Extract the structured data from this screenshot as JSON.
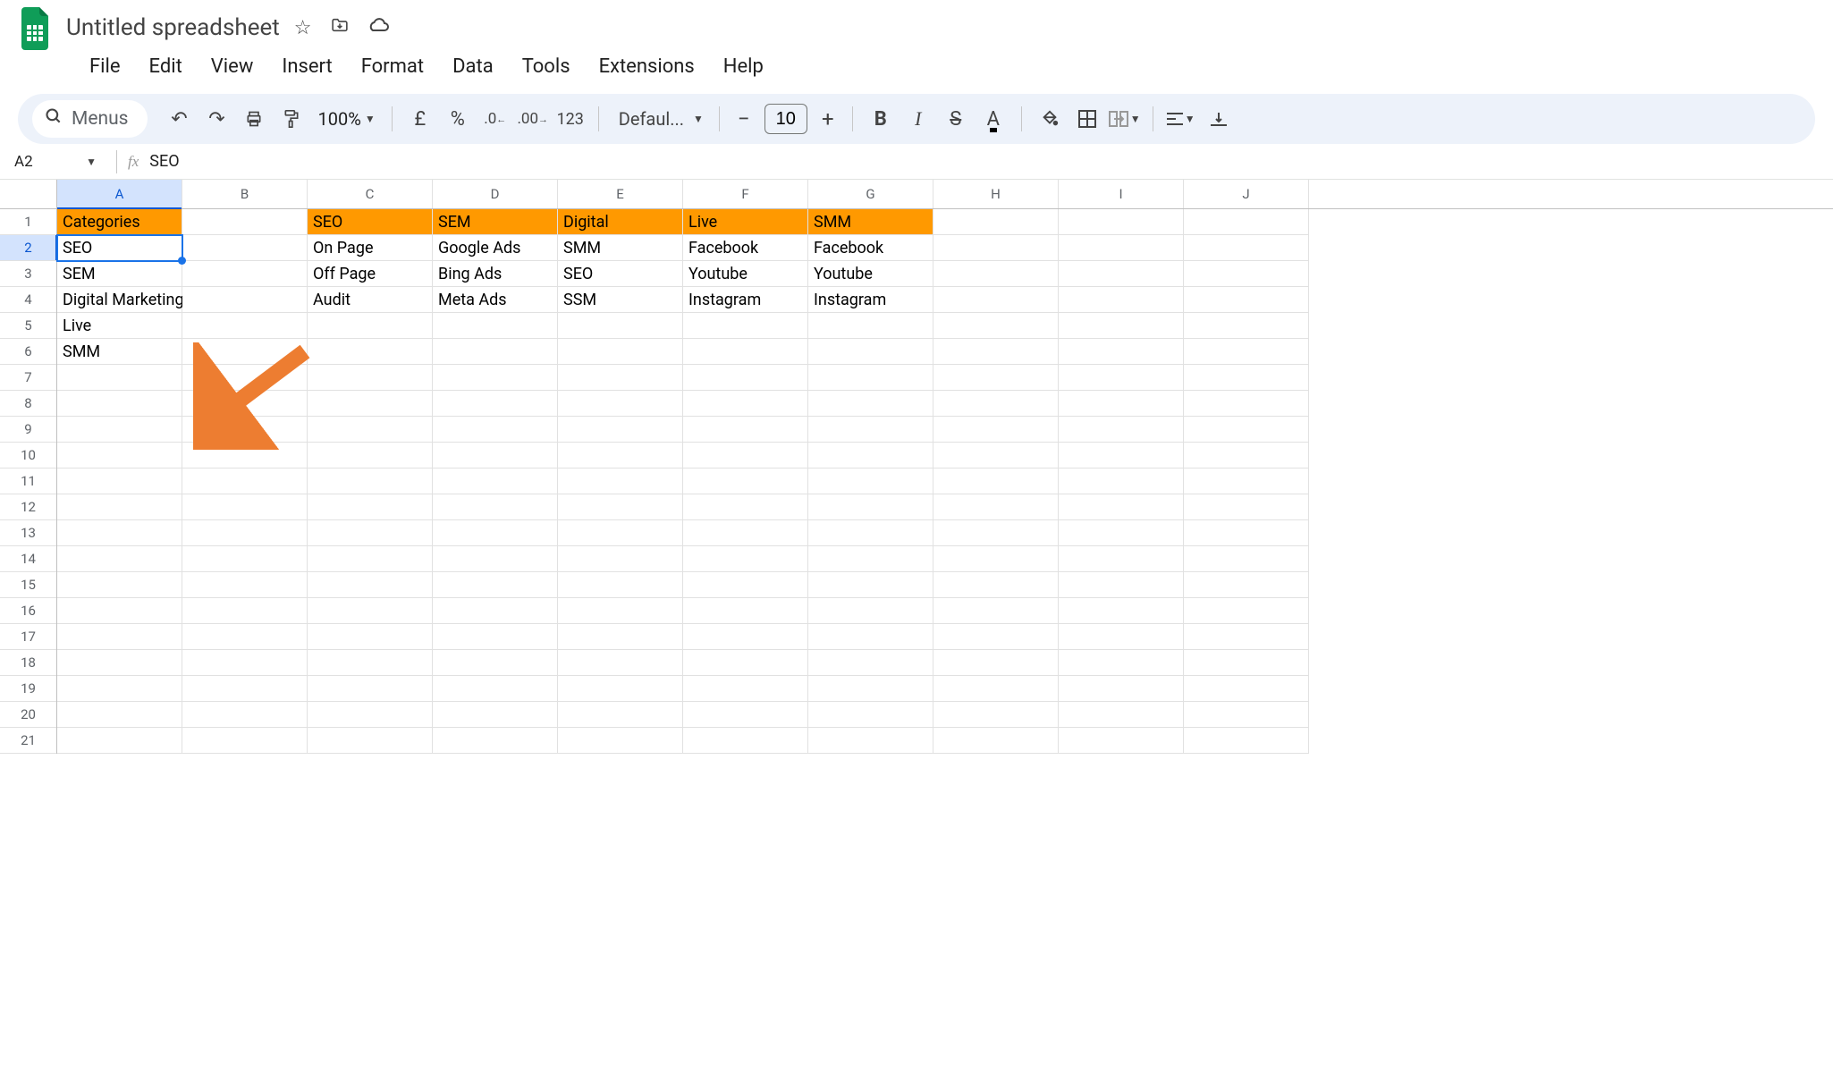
{
  "title": "Untitled spreadsheet",
  "menu": [
    "File",
    "Edit",
    "View",
    "Insert",
    "Format",
    "Data",
    "Tools",
    "Extensions",
    "Help"
  ],
  "toolbar": {
    "menus_label": "Menus",
    "zoom": "100%",
    "currency": "£",
    "percent": "%",
    "number": "123",
    "font": "Defaul...",
    "font_size": "10"
  },
  "namebox": "A2",
  "formula": "SEO",
  "columns": [
    "A",
    "B",
    "C",
    "D",
    "E",
    "F",
    "G",
    "H",
    "I",
    "J"
  ],
  "rows": [
    "1",
    "2",
    "3",
    "4",
    "5",
    "6",
    "7",
    "8",
    "9",
    "10",
    "11",
    "12",
    "13",
    "14",
    "15",
    "16",
    "17",
    "18",
    "19",
    "20",
    "21"
  ],
  "highlighted_cells": [
    [
      0,
      0
    ],
    [
      0,
      2
    ],
    [
      0,
      3
    ],
    [
      0,
      4
    ],
    [
      0,
      5
    ],
    [
      0,
      6
    ]
  ],
  "active_cell": [
    1,
    0
  ],
  "selected_col": 0,
  "selected_row": 1,
  "cells": [
    [
      "Categories",
      "",
      "SEO",
      "SEM",
      "Digital",
      "Live",
      "SMM",
      "",
      "",
      ""
    ],
    [
      "SEO",
      "",
      "On Page",
      "Google Ads",
      "SMM",
      "Facebook",
      "Facebook",
      "",
      "",
      ""
    ],
    [
      "SEM",
      "",
      "Off Page",
      "Bing Ads",
      "SEO",
      "Youtube",
      "Youtube",
      "",
      "",
      ""
    ],
    [
      "Digital Marketing",
      "",
      "Audit",
      "Meta Ads",
      "SSM",
      "Instagram",
      "Instagram",
      "",
      "",
      ""
    ],
    [
      "Live",
      "",
      "",
      "",
      "",
      "",
      "",
      "",
      "",
      ""
    ],
    [
      "SMM",
      "",
      "",
      "",
      "",
      "",
      "",
      "",
      "",
      ""
    ],
    [
      "",
      "",
      "",
      "",
      "",
      "",
      "",
      "",
      "",
      ""
    ],
    [
      "",
      "",
      "",
      "",
      "",
      "",
      "",
      "",
      "",
      ""
    ],
    [
      "",
      "",
      "",
      "",
      "",
      "",
      "",
      "",
      "",
      ""
    ],
    [
      "",
      "",
      "",
      "",
      "",
      "",
      "",
      "",
      "",
      ""
    ],
    [
      "",
      "",
      "",
      "",
      "",
      "",
      "",
      "",
      "",
      ""
    ],
    [
      "",
      "",
      "",
      "",
      "",
      "",
      "",
      "",
      "",
      ""
    ],
    [
      "",
      "",
      "",
      "",
      "",
      "",
      "",
      "",
      "",
      ""
    ],
    [
      "",
      "",
      "",
      "",
      "",
      "",
      "",
      "",
      "",
      ""
    ],
    [
      "",
      "",
      "",
      "",
      "",
      "",
      "",
      "",
      "",
      ""
    ],
    [
      "",
      "",
      "",
      "",
      "",
      "",
      "",
      "",
      "",
      ""
    ],
    [
      "",
      "",
      "",
      "",
      "",
      "",
      "",
      "",
      "",
      ""
    ],
    [
      "",
      "",
      "",
      "",
      "",
      "",
      "",
      "",
      "",
      ""
    ],
    [
      "",
      "",
      "",
      "",
      "",
      "",
      "",
      "",
      "",
      ""
    ],
    [
      "",
      "",
      "",
      "",
      "",
      "",
      "",
      "",
      "",
      ""
    ],
    [
      "",
      "",
      "",
      "",
      "",
      "",
      "",
      "",
      "",
      ""
    ]
  ]
}
